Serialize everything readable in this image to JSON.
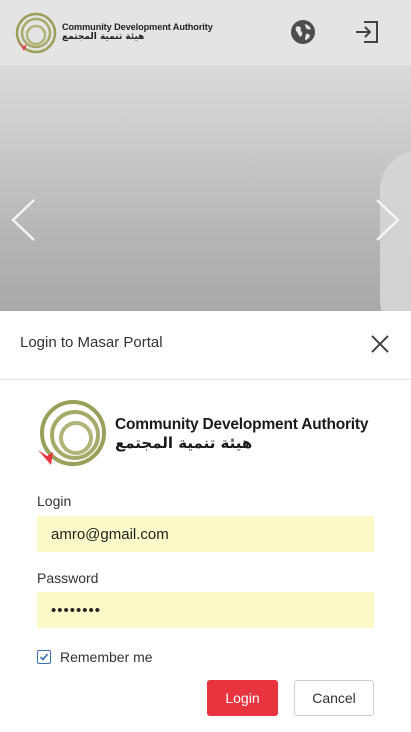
{
  "header": {
    "brand_en": "Community Development Authority",
    "brand_ar": "هيئة تنمية المجتمع",
    "globe_icon": "globe-icon",
    "login_icon": "sign-in-icon"
  },
  "hero": {
    "prev_icon": "chevron-left-icon",
    "next_icon": "chevron-right-icon"
  },
  "modal": {
    "title": "Login to Masar Portal",
    "close_icon": "close-icon",
    "brand_en": "Community Development Authority",
    "brand_ar": "هيئة تنمية المجتمع",
    "login_label": "Login",
    "login_value": "amro@gmail.com",
    "password_label": "Password",
    "password_value": "••••••••",
    "remember_label": "Remember me",
    "remember_checked": true,
    "login_button": "Login",
    "cancel_button": "Cancel"
  },
  "colors": {
    "accent_red": "#e8343f",
    "logo_olive": "#9aa05a",
    "input_fill": "#fafac8",
    "checkbox_blue": "#3a6fb0"
  }
}
